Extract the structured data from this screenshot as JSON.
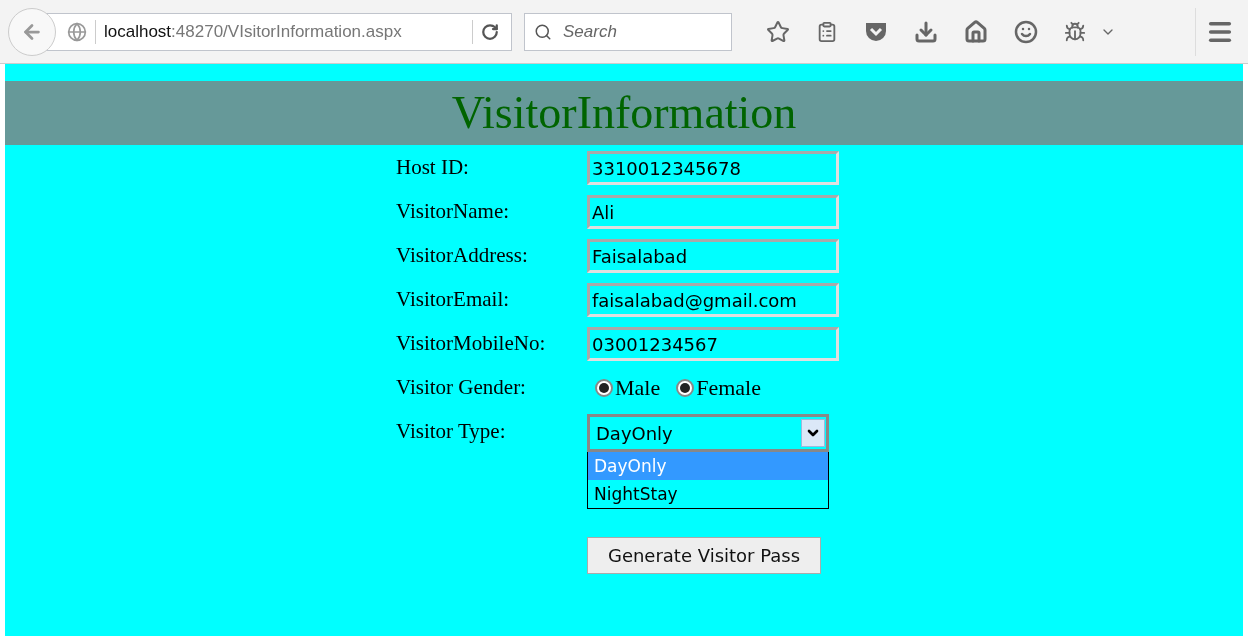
{
  "browser": {
    "url_host": "localhost",
    "url_path": ":48270/VIsitorInformation.aspx",
    "search_placeholder": "Search"
  },
  "page": {
    "title": "VisitorInformation",
    "fields": [
      {
        "label": "Host ID:",
        "value": "3310012345678"
      },
      {
        "label": "VisitorName:",
        "value": "Ali"
      },
      {
        "label": "VisitorAddress:",
        "value": "Faisalabad"
      },
      {
        "label": "VisitorEmail:",
        "value": "faisalabad@gmail.com"
      },
      {
        "label": "VisitorMobileNo:",
        "value": "03001234567"
      }
    ],
    "gender": {
      "label": "Visitor Gender:",
      "options": [
        {
          "label": "Male",
          "selected": true
        },
        {
          "label": "Female",
          "selected": true
        }
      ]
    },
    "visitor_type": {
      "label": "Visitor Type:",
      "value": "DayOnly",
      "expanded": true,
      "options": [
        {
          "label": "DayOnly",
          "selected": true
        },
        {
          "label": "NightStay",
          "selected": false
        }
      ]
    },
    "submit_button": "Generate Visitor Pass"
  }
}
